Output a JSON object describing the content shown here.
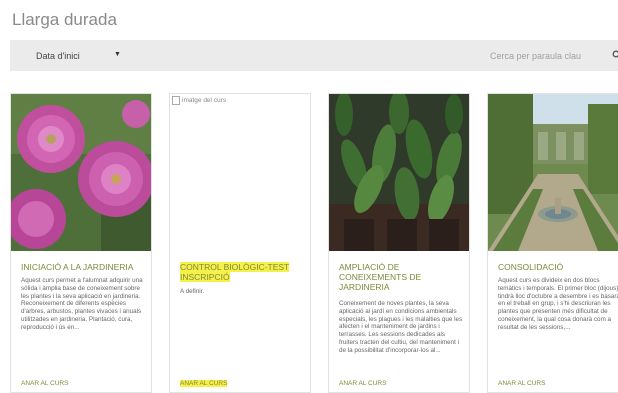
{
  "page": {
    "title": "Llarga durada"
  },
  "toolbar": {
    "sort_label": "Data d'inici",
    "search_placeholder": "Cerca per paraula clau"
  },
  "colors": {
    "accent": "#7d8a3a",
    "toolbar_bg": "#ebebeb",
    "highlight": "#f6f04a"
  },
  "cards": [
    {
      "title": "INICIACIÓ A LA JARDINERIA",
      "description": "Aquest curs permet a l'alumnat adquirir una sòlida i àmplia base de coneixement sobre les plantes i la seva aplicació en jardineria. Reconeixement de diferents espècies d'arbres, arbustos, plantes vivaces i anuals utilitzades en jardineria. Plantació, cura, reproducció i ús en...",
      "link": "ANAR AL CURS",
      "image": "pink-dahlias"
    },
    {
      "title": "CONTROL BIOLÒGIC-TEST INSCRIPCIÓ",
      "description": "A definir.",
      "link": "ANAR AL CURS",
      "image_alt": "imatge del curs"
    },
    {
      "title": "AMPLIACIÓ DE CONEIXEMENTS DE JARDINERIA",
      "description": "Coneixement de noves plantes, la seva aplicació al jardí en condicions ambientals especials, les plagues i les malalties que les afecten i el manteniment de jardins i terrasses. Les sessions dedicades als fruiters tracten del cultiu, del manteniment i de la possibilitat d'incorporar-los al...",
      "link": "ANAR AL CURS",
      "image": "potted-plants"
    },
    {
      "title": "CONSOLIDACIÓ",
      "description": "Aquest curs es divideix en dos blocs temàtics i temporals. El primer bloc (dijous) tindrà lloc d'octubre a desembre i es basarà en el treball en grup, i s'hi descriuran les plantes que presenten més dificultat de coneixement, la qual cosa donarà com a resultat de les sessions,...",
      "link": "ANAR AL CURS",
      "image": "formal-garden"
    }
  ]
}
